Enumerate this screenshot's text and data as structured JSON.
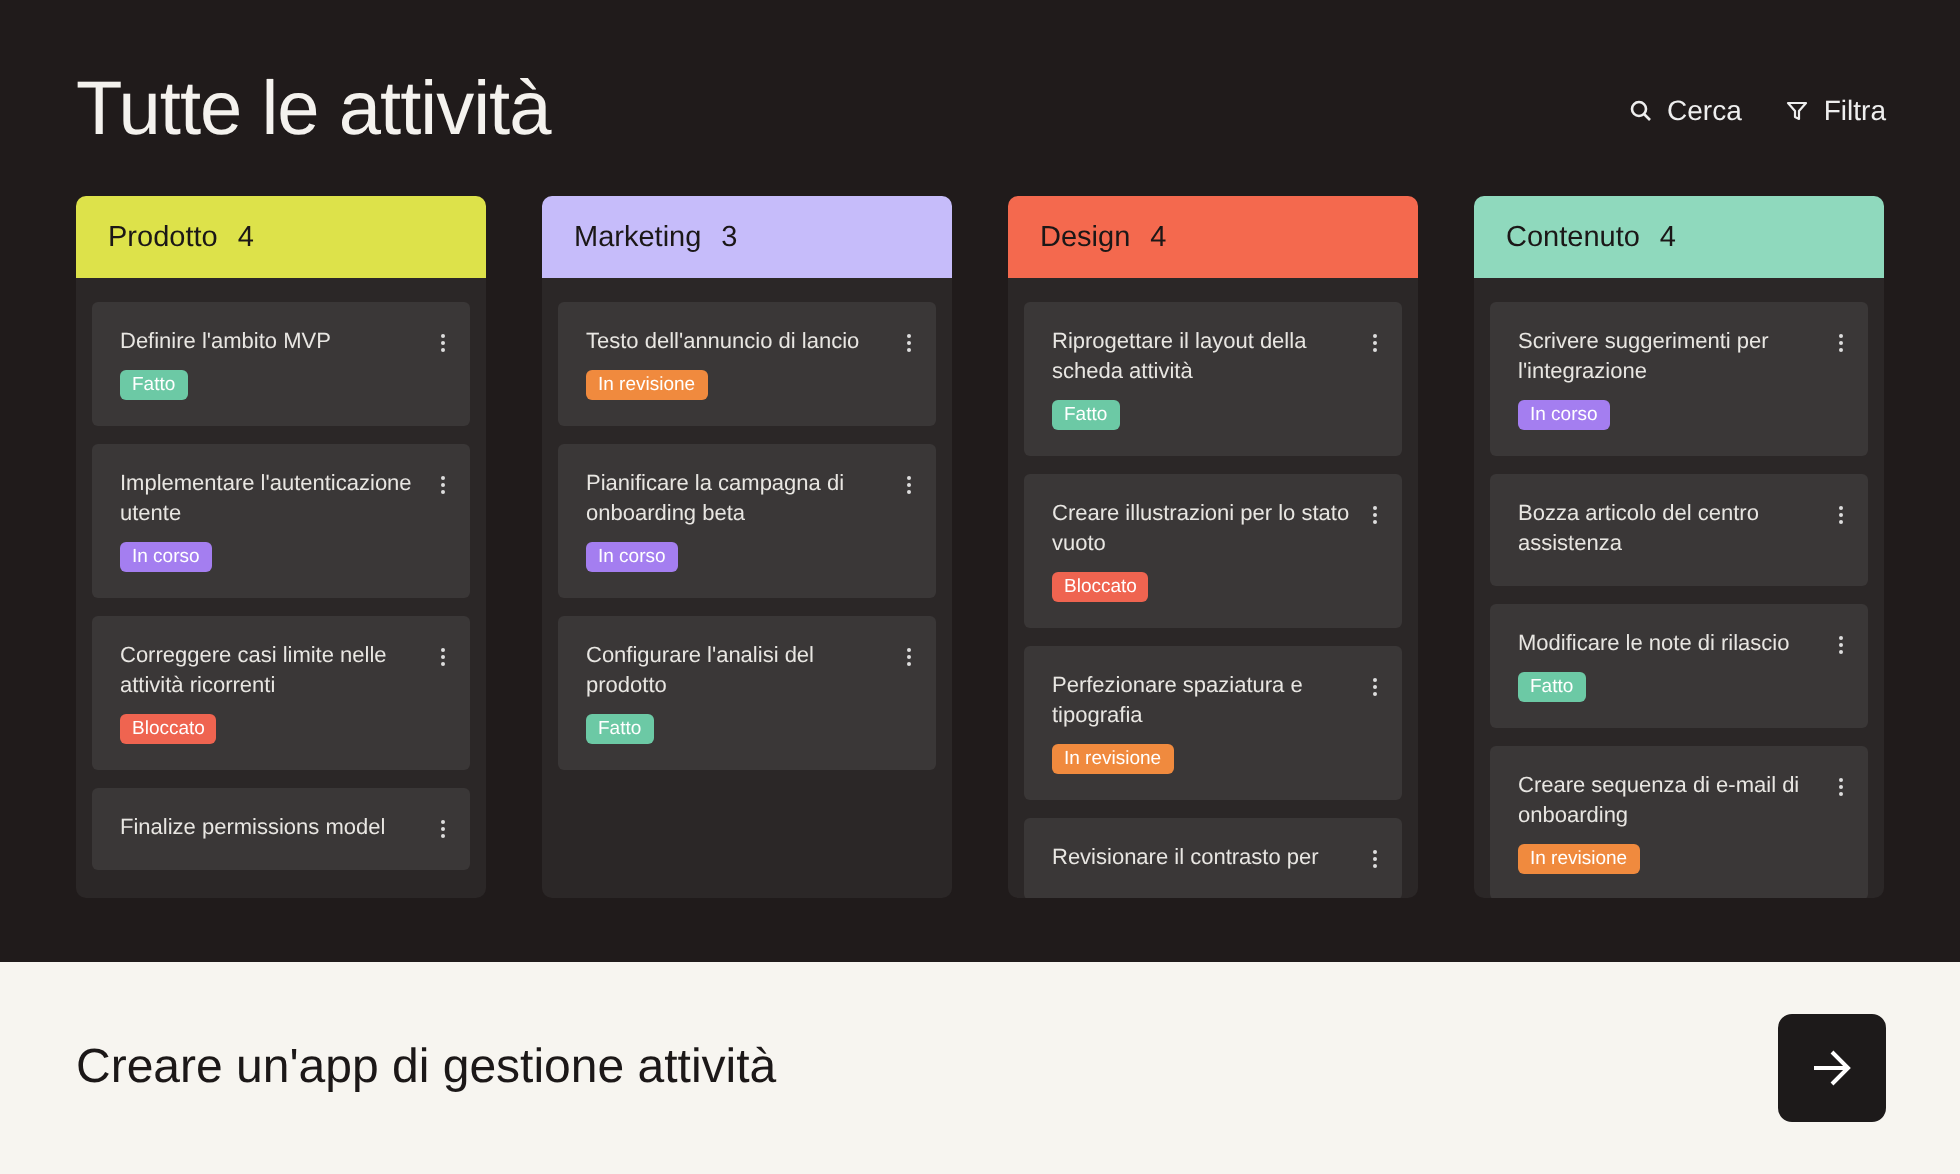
{
  "header": {
    "title": "Tutte le attività",
    "actions": [
      {
        "kind": "search",
        "label": "Cerca"
      },
      {
        "kind": "filter",
        "label": "Filtra"
      }
    ]
  },
  "columns": [
    {
      "name": "Prodotto",
      "count": "4",
      "color": "#dde24a",
      "cards": [
        {
          "title": "Definire l'ambito MVP",
          "tag": {
            "label": "Fatto",
            "color": "#6cc9a5"
          }
        },
        {
          "title": "Implementare l'autenticazione utente",
          "tag": {
            "label": "In corso",
            "color": "#a47ef0"
          }
        },
        {
          "title": "Correggere casi limite nelle attività ricorrenti",
          "tag": {
            "label": "Bloccato",
            "color": "#ef6450"
          }
        },
        {
          "title": "Finalize permissions model"
        }
      ]
    },
    {
      "name": "Marketing",
      "count": "3",
      "color": "#c6bcfa",
      "cards": [
        {
          "title": "Testo dell'annuncio di lancio",
          "tag": {
            "label": "In revisione",
            "color": "#f08a3e"
          }
        },
        {
          "title": "Pianificare la campagna di onboarding beta",
          "tag": {
            "label": "In corso",
            "color": "#a47ef0"
          }
        },
        {
          "title": "Configurare l'analisi del prodotto",
          "tag": {
            "label": "Fatto",
            "color": "#6cc9a5"
          }
        }
      ]
    },
    {
      "name": "Design",
      "count": "4",
      "color": "#f4694e",
      "cards": [
        {
          "title": "Riprogettare il layout della scheda attività",
          "tag": {
            "label": "Fatto",
            "color": "#6cc9a5"
          }
        },
        {
          "title": "Creare illustrazioni per lo stato vuoto",
          "tag": {
            "label": "Bloccato",
            "color": "#ef6450"
          }
        },
        {
          "title": "Perfezionare spaziatura e tipografia",
          "tag": {
            "label": "In revisione",
            "color": "#f08a3e"
          }
        },
        {
          "title": "Revisionare il contrasto per"
        }
      ]
    },
    {
      "name": "Contenuto",
      "count": "4",
      "color": "#8fd9bd",
      "cards": [
        {
          "title": "Scrivere suggerimenti per l'integrazione",
          "tag": {
            "label": "In corso",
            "color": "#a47ef0"
          }
        },
        {
          "title": "Bozza articolo del centro assistenza"
        },
        {
          "title": "Modificare le note di rilascio",
          "tag": {
            "label": "Fatto",
            "color": "#6cc9a5"
          }
        },
        {
          "title": "Creare sequenza di e-mail di onboarding",
          "tag": {
            "label": "In revisione",
            "color": "#f08a3e"
          }
        }
      ]
    }
  ],
  "footer": {
    "caption": "Creare un'app di gestione attività"
  }
}
